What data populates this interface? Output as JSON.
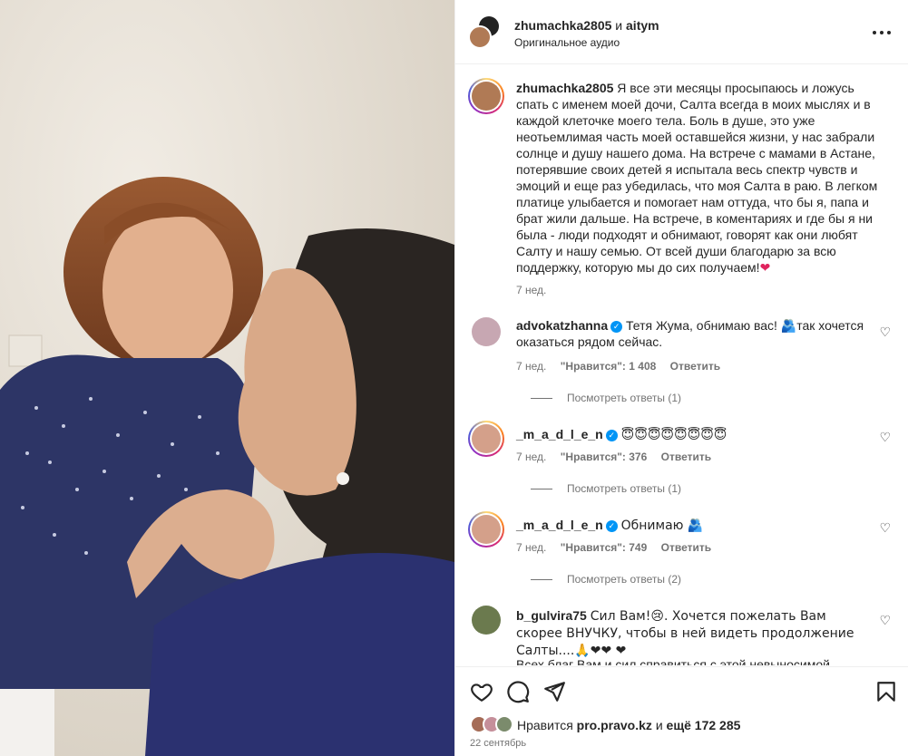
{
  "post": {
    "header": {
      "username": "zhumachka2805",
      "and": "и",
      "collab": "aitym",
      "audio": "Оригинальное аудио"
    },
    "caption": {
      "username": "zhumachka2805",
      "text": "Я все эти месяцы просыпаюсь и ложусь спать с именем моей дочи, Салта всегда в моих мыслях и в каждой клеточке моего тела. Боль в душе, это уже неотьемлимая часть моей оставшейся жизни, у нас забрали солнце и душу нашего дома. На встрече с мамами в Астане, потерявшие своих детей я испытала весь спектр чувств и эмоций и еще раз убедилась, что моя Салта в раю. В легком платице улыбается и помогает нам оттуда, что бы я, папа и брат жили дальше. На встрече, в коментариях и где бы я ни была - люди подходят и обнимают, говорят как они любят Салту и нашу семью. От всей души благодарю за всю поддержку, которую мы до сих получаем!",
      "emoji": "❤",
      "time": "7 нед."
    },
    "comments": [
      {
        "username": "advokatzhanna",
        "verified": true,
        "text": "Тетя Жума, обнимаю вас! 🫂так хочется оказаться рядом сейчас.",
        "time": "7 нед.",
        "likes": "\"Нравится\": 1 408",
        "reply": "Ответить",
        "view_replies": "Посмотреть ответы (1)"
      },
      {
        "username": "_m_a_d_l_e_n",
        "verified": true,
        "text": "😇😇😇😇😇😇😇😇",
        "time": "7 нед.",
        "likes": "\"Нравится\": 376",
        "reply": "Ответить",
        "view_replies": "Посмотреть ответы (1)"
      },
      {
        "username": "_m_a_d_l_e_n",
        "verified": true,
        "text": "Обнимаю 🫂",
        "time": "7 нед.",
        "likes": "\"Нравится\": 749",
        "reply": "Ответить",
        "view_replies": "Посмотреть ответы (2)"
      },
      {
        "username": "b_gulvira75",
        "verified": false,
        "text": "Сил Вам!😢. Хочется пожелать Вам скорее ВНУЧКУ, чтобы в ней видеть продолжение Салты....🙏❤❤ ❤",
        "text_more": "Всех благ Вам и сил справиться с этой невыносимой болью"
      }
    ],
    "footer": {
      "liked_by_prefix": "Нравится",
      "liked_by_user": "pro.pravo.kz",
      "liked_by_and": "и",
      "liked_by_count": "ещё 172 285",
      "date": "22 сентябрь"
    },
    "icons": {
      "like": "heart-icon",
      "comment": "comment-icon",
      "share": "share-icon",
      "save": "bookmark-icon",
      "more": "more-icon"
    },
    "colors": {
      "verified": "#0095f6",
      "heart": "#e0245e",
      "muted": "#737373"
    }
  }
}
